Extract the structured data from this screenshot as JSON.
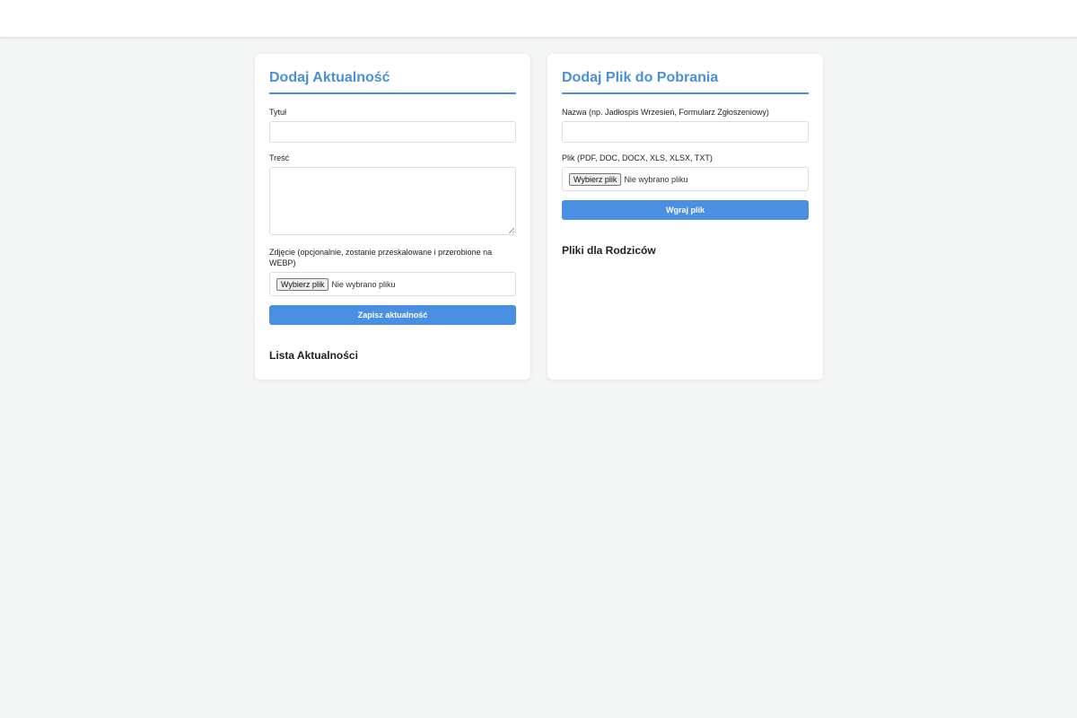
{
  "news_form": {
    "title": "Dodaj Aktualność",
    "title_label": "Tytuł",
    "content_label": "Treść",
    "image_label": "Zdjęcie (opcjonalnie, zostanie przeskalowane i przerobione na WEBP)",
    "file_button": "Wybierz plik",
    "file_status": "Nie wybrano pliku",
    "submit": "Zapisz aktualność",
    "list_heading": "Lista Aktualności"
  },
  "download_form": {
    "title": "Dodaj Plik do Pobrania",
    "name_label": "Nazwa (np. Jadłospis Wrzesień, Formularz Zgłoszeniowy)",
    "file_label": "Plik (PDF, DOC, DOCX, XLS, XLSX, TXT)",
    "file_button": "Wybierz plik",
    "file_status": "Nie wybrano pliku",
    "submit": "Wgraj plik",
    "list_heading": "Pliki dla Rodziców"
  },
  "colors": {
    "accent": "#4a90d9",
    "button": "#4a90e2",
    "background": "#f4f5f5"
  }
}
